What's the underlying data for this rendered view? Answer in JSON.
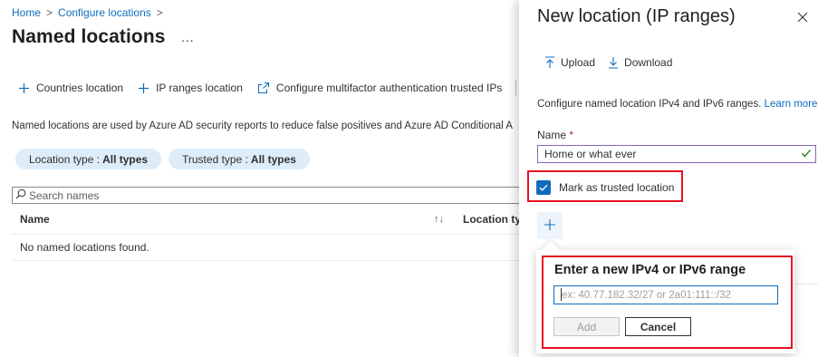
{
  "breadcrumb": {
    "home": "Home",
    "separator": ">",
    "configure": "Configure locations"
  },
  "page": {
    "title": "Named locations",
    "more": "..."
  },
  "toolbar": {
    "countries_label": "Countries location",
    "ip_ranges_label": "IP ranges location",
    "mfa_label": "Configure multifactor authentication trusted IPs"
  },
  "description": "Named locations are used by Azure AD security reports to reduce false positives and Azure AD Conditional A",
  "filters": [
    {
      "label": "Location type :",
      "value": "All types"
    },
    {
      "label": "Trusted type :",
      "value": "All types"
    }
  ],
  "search": {
    "placeholder": "Search names"
  },
  "table": {
    "col_name": "Name",
    "col_location_type": "Location typ",
    "sort_icon": "↑↓",
    "empty_text": "No named locations found."
  },
  "panel": {
    "title": "New location (IP ranges)",
    "upload_label": "Upload",
    "download_label": "Download",
    "description": "Configure named location IPv4 and IPv6 ranges.",
    "learn_more": "Learn more",
    "name_label": "Name",
    "required_mark": "*",
    "name_value": "Home or what ever",
    "trusted_label": "Mark as trusted location",
    "trusted_checked": true
  },
  "callout": {
    "title": "Enter a new IPv4 or IPv6 range",
    "placeholder": "ex: 40.77.182.32/27 or 2a01:111::/32",
    "add_label": "Add",
    "cancel_label": "Cancel"
  },
  "colors": {
    "accent": "#0f6cbd",
    "highlight": "#e81123",
    "pill_bg": "#dcecf9",
    "valid": "#107c10"
  }
}
